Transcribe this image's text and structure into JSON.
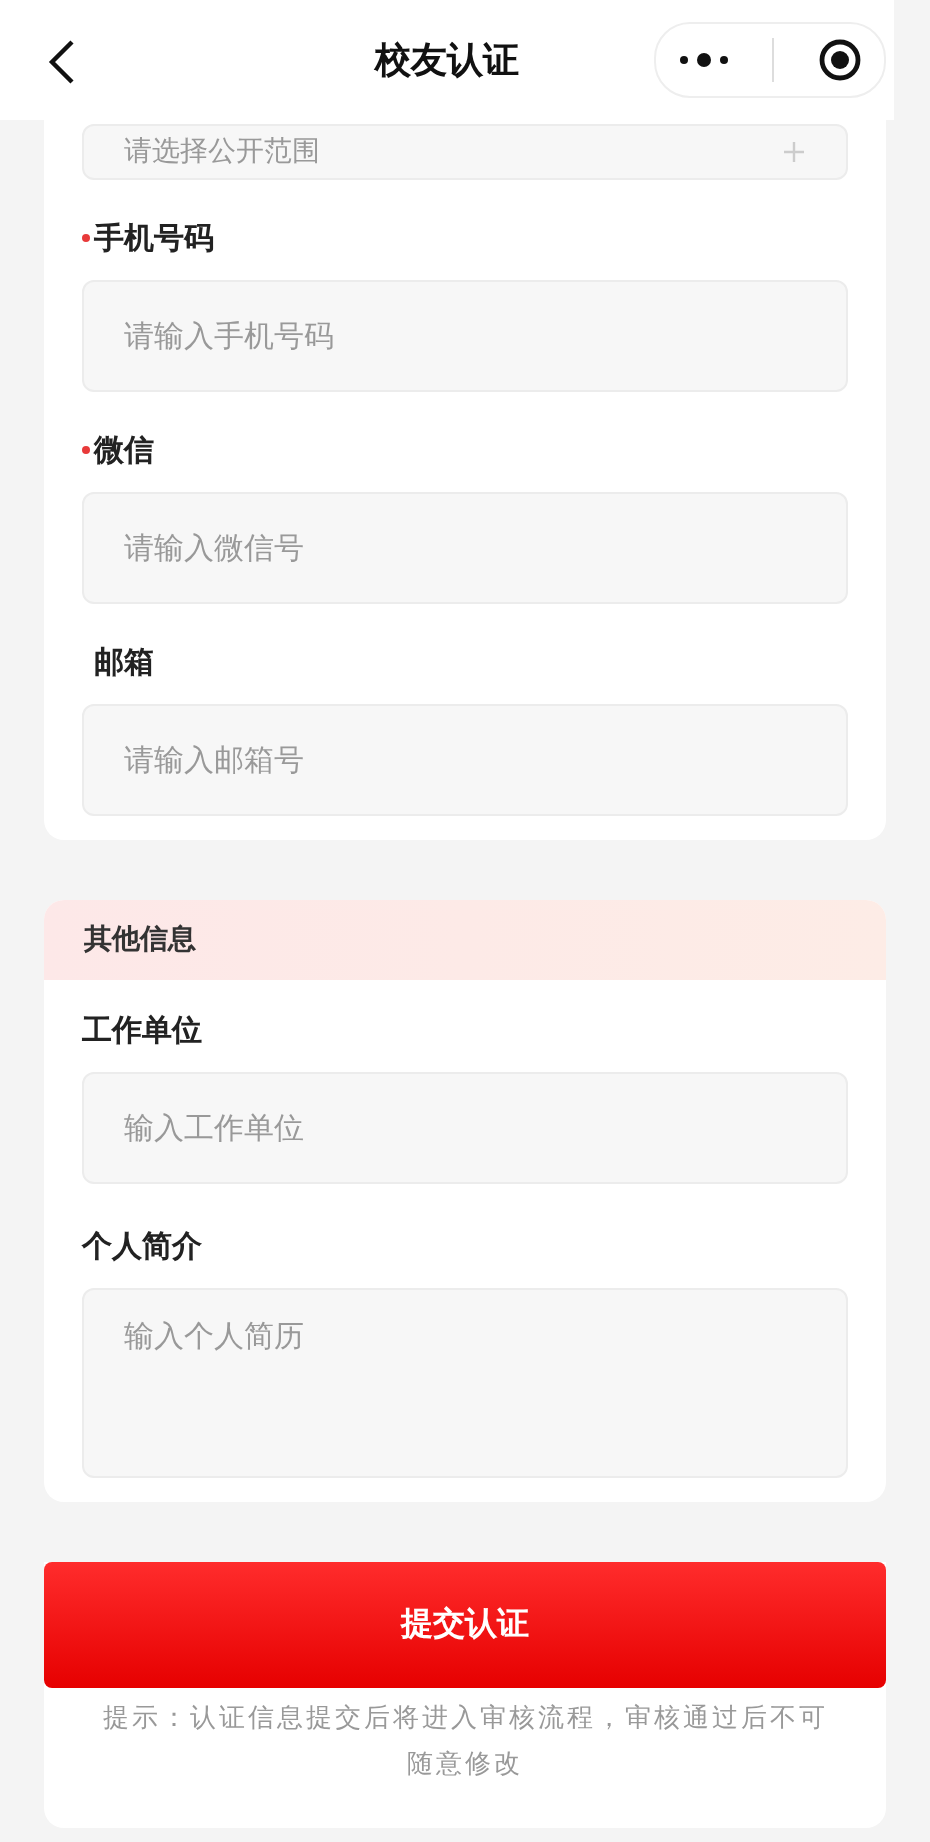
{
  "nav": {
    "title": "校友认证"
  },
  "top_field": {
    "placeholder": "请选择公开范围"
  },
  "contact_fields": [
    {
      "label": "手机号码",
      "required": true,
      "placeholder": "请输入手机号码"
    },
    {
      "label": "微信",
      "required": true,
      "placeholder": "请输入微信号"
    },
    {
      "label": "邮箱",
      "required": false,
      "placeholder": "请输入邮箱号"
    }
  ],
  "other_section": {
    "title": "其他信息",
    "fields": [
      {
        "label": "工作单位",
        "kind": "input",
        "placeholder": "输入工作单位"
      },
      {
        "label": "个人简介",
        "kind": "textarea",
        "placeholder": "输入个人简历"
      }
    ]
  },
  "submit_button": "提交认证",
  "tip": "提示：认证信息提交后将进入审核流程，审核通过后不可随意修改"
}
